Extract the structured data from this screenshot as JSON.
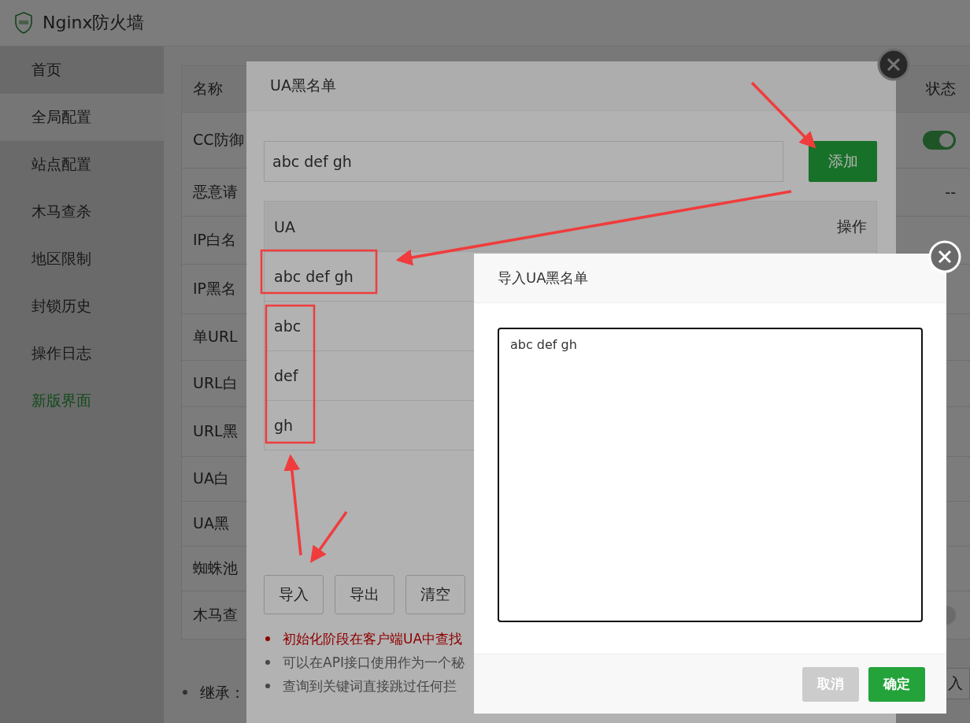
{
  "header": {
    "title": "Nginx防火墙"
  },
  "sidebar": {
    "items": [
      {
        "label": "首页",
        "selected": false,
        "accent": false
      },
      {
        "label": "全局配置",
        "selected": true,
        "accent": false
      },
      {
        "label": "站点配置",
        "selected": false,
        "accent": false
      },
      {
        "label": "木马查杀",
        "selected": false,
        "accent": false
      },
      {
        "label": "地区限制",
        "selected": false,
        "accent": false
      },
      {
        "label": "封锁历史",
        "selected": false,
        "accent": false
      },
      {
        "label": "操作日志",
        "selected": false,
        "accent": false
      },
      {
        "label": "新版界面",
        "selected": false,
        "accent": true
      }
    ]
  },
  "table": {
    "columns": [
      "名称",
      "状态"
    ],
    "rows": [
      {
        "name": "CC防御",
        "kind": "toggle",
        "on": true
      },
      {
        "name": "恶意请",
        "kind": "text",
        "status": "--"
      },
      {
        "name": "IP白名",
        "kind": "none"
      },
      {
        "name": "IP黑名",
        "kind": "none"
      },
      {
        "name": "单URL",
        "kind": "none"
      },
      {
        "name": "URL白",
        "kind": "none"
      },
      {
        "name": "URL黑",
        "kind": "none"
      },
      {
        "name": "UA白",
        "kind": "none"
      },
      {
        "name": "UA黑",
        "kind": "none"
      },
      {
        "name": "蜘蛛池",
        "kind": "none"
      },
      {
        "name": "木马查",
        "kind": "toggle",
        "on": false
      }
    ],
    "side_button": "入",
    "notes": [
      "继承："
    ]
  },
  "ua_dialog": {
    "title": "UA黑名单",
    "input_value": "abc def gh",
    "add_button": "添加",
    "columns": [
      "UA",
      "操作"
    ],
    "rows": [
      {
        "ua": "abc def gh"
      },
      {
        "ua": "abc"
      },
      {
        "ua": "def"
      },
      {
        "ua": "gh"
      }
    ],
    "buttons": [
      "导入",
      "导出",
      "清空"
    ],
    "notes": [
      {
        "text": "初始化阶段在客户端UA中查找",
        "warning": true
      },
      {
        "text": "可以在API接口使用作为一个秘",
        "warning": false
      },
      {
        "text": "查询到关键词直接跳过任何拦",
        "warning": false
      }
    ]
  },
  "import_dialog": {
    "title": "导入UA黑名单",
    "textarea_value": "abc def gh",
    "cancel_button": "取消",
    "confirm_button": "确定"
  }
}
